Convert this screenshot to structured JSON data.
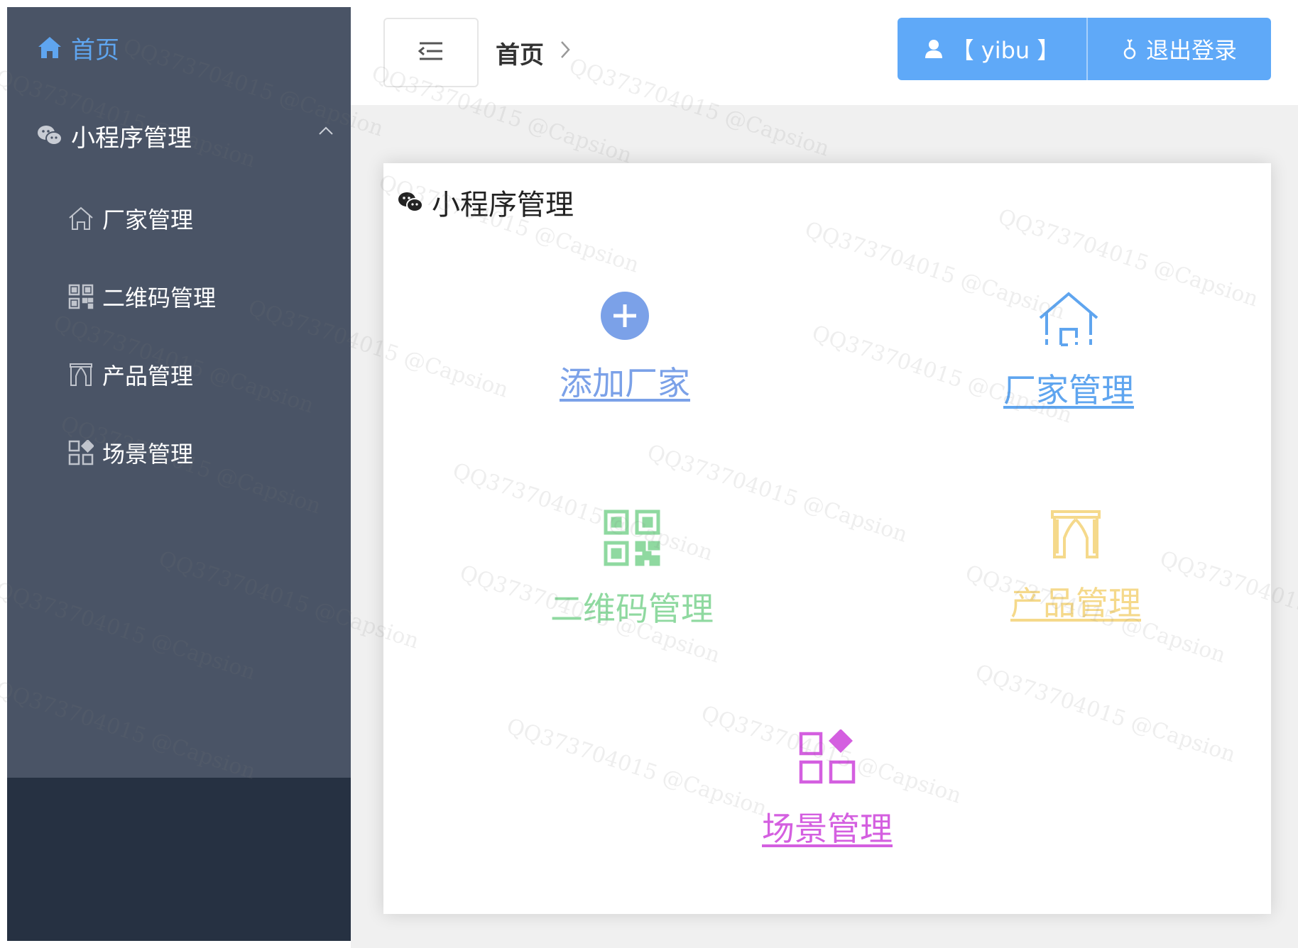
{
  "sidebar": {
    "home_label": "首页",
    "group_label": "小程序管理",
    "items": [
      {
        "label": "厂家管理"
      },
      {
        "label": "二维码管理"
      },
      {
        "label": "产品管理"
      },
      {
        "label": "场景管理"
      }
    ]
  },
  "header": {
    "breadcrumb": "首页",
    "user_label": "【 yibu 】",
    "logout_label": "退出登录"
  },
  "card": {
    "title": "小程序管理",
    "tiles": [
      {
        "label": "添加厂家",
        "color": "#7ba1e8"
      },
      {
        "label": "厂家管理",
        "color": "#5fa5ef"
      },
      {
        "label": "二维码管理",
        "color": "#8fd9a0"
      },
      {
        "label": "产品管理",
        "color": "#f5d98b"
      },
      {
        "label": "场景管理",
        "color": "#d45fe0"
      }
    ]
  },
  "watermark": "QQ373704015 @Capsion",
  "colors": {
    "sidebar_bg": "#4a5466",
    "sidebar_bottom": "#263142",
    "accent": "#5fa9f8"
  }
}
